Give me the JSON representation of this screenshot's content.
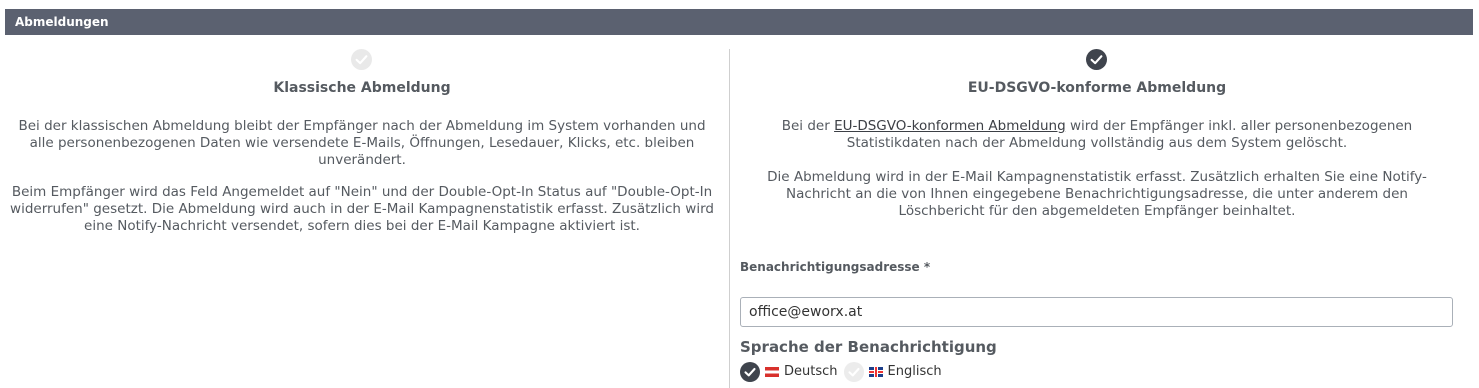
{
  "header": {
    "title": "Abmeldungen"
  },
  "classic": {
    "icon": "check-circle-icon",
    "selected": false,
    "title": "Klassische Abmeldung",
    "paragraph1": "Bei der klassischen Abmeldung bleibt der Empfänger nach der Abmeldung im System vorhanden und alle personenbezogenen Daten wie versendete E-Mails, Öffnungen, Lesedauer, Klicks, etc. bleiben unverändert.",
    "paragraph2": "Beim Empfänger wird das Feld Angemeldet auf \"Nein\" und der Double-Opt-In Status auf \"Double-Opt-In widerrufen\" gesetzt. Die Abmeldung wird auch in der E-Mail Kampagnenstatistik erfasst. Zusätzlich wird eine Notify-Nachricht versendet, sofern dies bei der E-Mail Kampagne aktiviert ist."
  },
  "gdpr": {
    "icon": "check-circle-icon",
    "selected": true,
    "title": "EU-DSGVO-konforme Abmeldung",
    "paragraph1_prefix": "Bei der ",
    "paragraph1_link": "EU-DSGVO-konformen Abmeldung",
    "paragraph1_suffix": " wird der Empfänger inkl. aller personenbezogenen Statistikdaten nach der Abmeldung vollständig aus dem System gelöscht.",
    "paragraph2": "Die Abmeldung wird in der E-Mail Kampagnenstatistik erfasst. Zusätzlich erhalten Sie eine Notify-Nachricht an die von Ihnen eingegebene Benachrichtigungsadresse, die unter anderem den Löschbericht für den abgemeldeten Empfänger beinhaltet.",
    "notification_label": "Benachrichtigungsadresse *",
    "notification_value": "office@eworx.at",
    "language_title": "Sprache der Benachrichtigung",
    "languages": [
      {
        "label": "Deutsch",
        "flag": "austria-flag",
        "selected": true
      },
      {
        "label": "Englisch",
        "flag": "uk-flag",
        "selected": false
      }
    ]
  },
  "colors": {
    "header_bg": "#5b6170",
    "active_check": "#3f444d",
    "inactive_check": "#e9e9e9",
    "text": "#555a60"
  }
}
